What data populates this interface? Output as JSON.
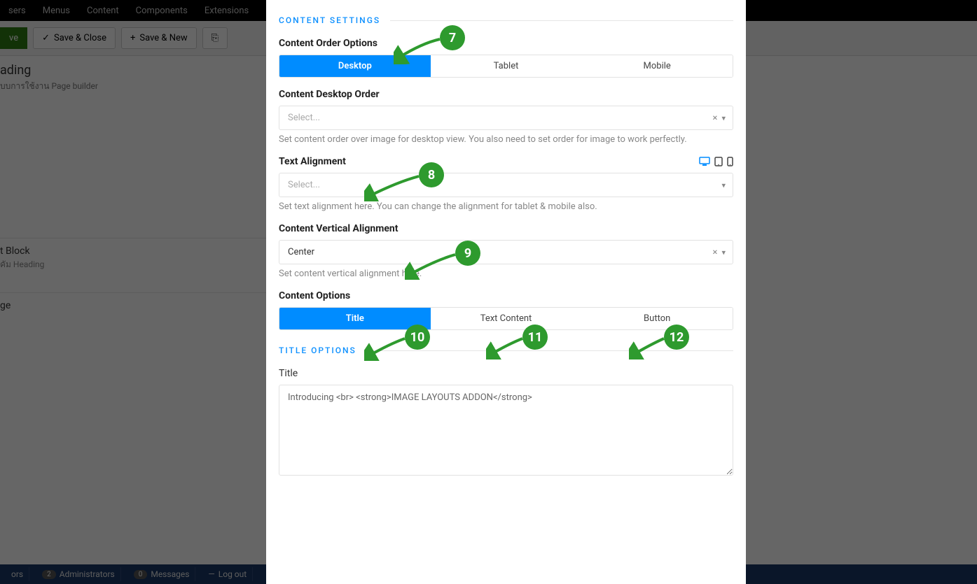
{
  "bg": {
    "topbar": [
      "sers",
      "Menus",
      "Content",
      "Components",
      "Extensions"
    ],
    "buttons": {
      "save": "ve",
      "saveclose": "Save & Close",
      "savenew": "Save & New"
    },
    "heading": "ading",
    "subheading": "บบการใช้งาน Page builder",
    "block1_title": "t Block",
    "block1_sub": "คัม Heading",
    "block2_title": "ge",
    "status": {
      "ors": "ors",
      "admins_n": "2",
      "admins": "Administrators",
      "msgs_n": "0",
      "msgs": "Messages",
      "logout": "Log out"
    }
  },
  "sections": {
    "content_settings": "CONTENT SETTINGS",
    "title_options": "TITLE OPTIONS"
  },
  "content_order": {
    "label": "Content Order Options",
    "tabs": [
      "Desktop",
      "Tablet",
      "Mobile"
    ]
  },
  "desktop_order": {
    "label": "Content Desktop Order",
    "placeholder": "Select...",
    "help": "Set content order over image for desktop view. You also need to set order for image to work perfectly."
  },
  "text_align": {
    "label": "Text Alignment",
    "placeholder": "Select...",
    "help": "Set text alignment here. You can change the alignment for tablet & mobile also."
  },
  "vert_align": {
    "label": "Content Vertical Alignment",
    "value": "Center",
    "help": "Set content vertical alignment here."
  },
  "content_options": {
    "label": "Content Options",
    "tabs": [
      "Title",
      "Text Content",
      "Button"
    ]
  },
  "title_field": {
    "label": "Title",
    "value": "Introducing <br> <strong>IMAGE LAYOUTS ADDON</strong>"
  },
  "markers": {
    "m7": "7",
    "m8": "8",
    "m9": "9",
    "m10": "10",
    "m11": "11",
    "m12": "12"
  }
}
